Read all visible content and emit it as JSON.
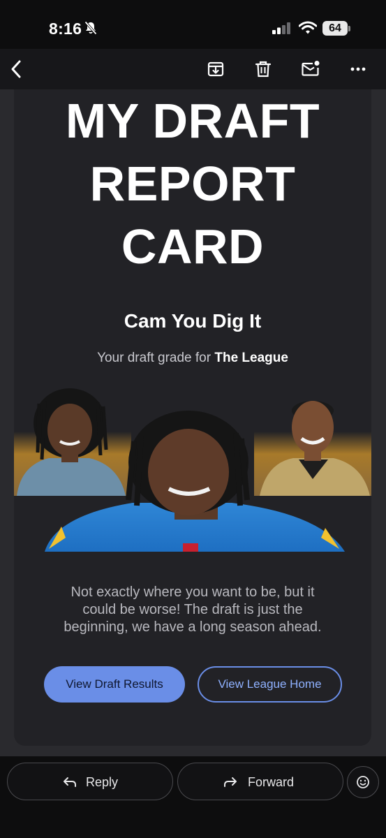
{
  "status_bar": {
    "time": "8:16",
    "battery": "64",
    "icons": [
      "bell-muted-icon",
      "cellular-signal-icon",
      "wifi-icon",
      "battery-icon"
    ]
  },
  "toolbar": {
    "icons": [
      "back-chevron-icon",
      "archive-icon",
      "trash-icon",
      "mark-unread-icon",
      "more-options-icon"
    ]
  },
  "email": {
    "headline_lines": [
      "MY DRAFT",
      "REPORT",
      "CARD"
    ],
    "team_name": "Cam You Dig It",
    "grade_prefix": "Your draft grade for ",
    "league_name": "The League",
    "message": "Not exactly where you want to be, but it could be worse! The draft is just the beginning, we have a long season ahead.",
    "buttons": {
      "primary": "View Draft Results",
      "secondary": "View League Home"
    },
    "colors": {
      "card_bg": "#222226",
      "accent_blue": "#6a8ee7",
      "gold_gradient": "#c9962e"
    }
  },
  "actions": {
    "reply_label": "Reply",
    "forward_label": "Forward",
    "emoji_icon": "emoji-reaction-icon"
  }
}
